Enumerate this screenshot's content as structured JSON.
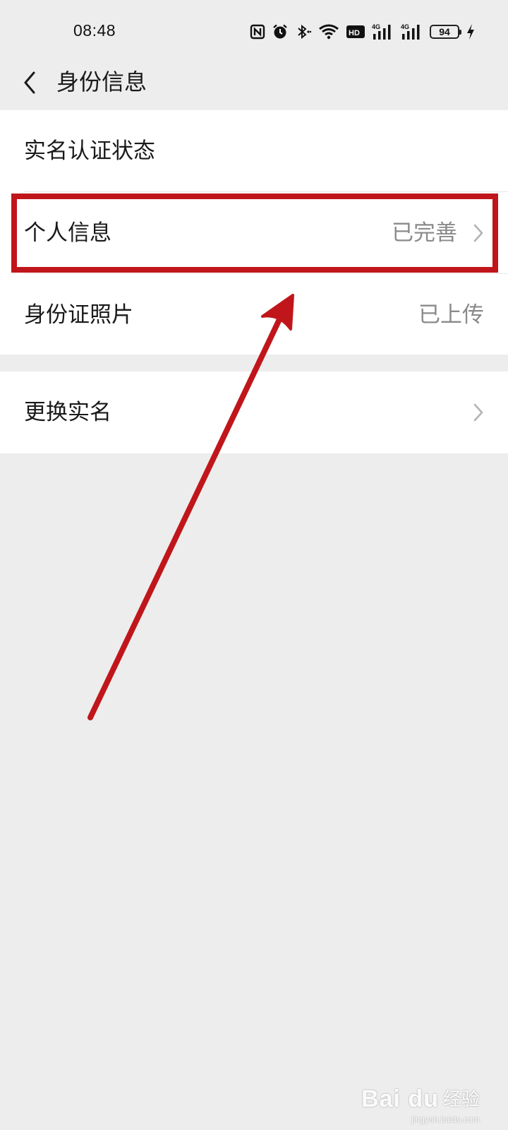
{
  "status_bar": {
    "time": "08:48",
    "battery_level": "94",
    "network_1": "4G",
    "network_2": "4G",
    "hd_badge": "HD",
    "icons": [
      "nfc-icon",
      "alarm-icon",
      "bluetooth-icon",
      "wifi-icon",
      "hd-voice-icon",
      "signal-icon",
      "signal-icon",
      "battery-icon",
      "charging-icon"
    ]
  },
  "nav": {
    "title": "身份信息",
    "back_icon": "chevron-left-icon"
  },
  "groups": [
    {
      "rows": [
        {
          "label": "实名认证状态",
          "value": "",
          "chevron": false
        },
        {
          "label": "个人信息",
          "value": "已完善",
          "chevron": true
        },
        {
          "label": "身份证照片",
          "value": "已上传",
          "chevron": false
        }
      ]
    },
    {
      "rows": [
        {
          "label": "更换实名",
          "value": "",
          "chevron": true
        }
      ]
    }
  ],
  "annotation": {
    "color": "#c0161b",
    "highlight_target": "个人信息"
  },
  "watermark": {
    "brand": "Bai du",
    "cn": "经验",
    "url": "jingyan.baidu.com"
  },
  "colors": {
    "background": "#ededed",
    "card": "#ffffff",
    "text_primary": "#1a1a1a",
    "text_secondary": "#8a8a8a",
    "annotation_red": "#c0161b"
  }
}
